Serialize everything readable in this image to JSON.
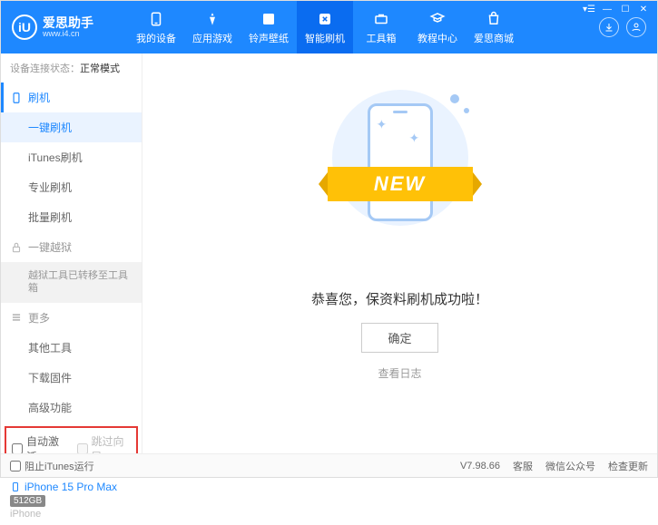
{
  "header": {
    "logo_badge": "iU",
    "logo_title": "爱思助手",
    "logo_sub": "www.i4.cn"
  },
  "topnav": [
    {
      "label": "我的设备"
    },
    {
      "label": "应用游戏"
    },
    {
      "label": "铃声壁纸"
    },
    {
      "label": "智能刷机"
    },
    {
      "label": "工具箱"
    },
    {
      "label": "教程中心"
    },
    {
      "label": "爱思商城"
    }
  ],
  "status": {
    "label": "设备连接状态：",
    "value": "正常模式"
  },
  "sidebar": {
    "flash_header": "刷机",
    "flash_items": [
      "一键刷机",
      "iTunes刷机",
      "专业刷机",
      "批量刷机"
    ],
    "jailbreak_header": "一键越狱",
    "jailbreak_note": "越狱工具已转移至工具箱",
    "more_header": "更多",
    "more_items": [
      "其他工具",
      "下载固件",
      "高级功能"
    ],
    "auto_activate": "自动激活",
    "skip_guide": "跳过向导"
  },
  "device": {
    "name": "iPhone 15 Pro Max",
    "storage": "512GB",
    "type": "iPhone"
  },
  "main": {
    "new_text": "NEW",
    "success_msg": "恭喜您，保资料刷机成功啦！",
    "ok_btn": "确定",
    "log_link": "查看日志"
  },
  "footer": {
    "block_itunes": "阻止iTunes运行",
    "version": "V7.98.66",
    "links": [
      "客服",
      "微信公众号",
      "检查更新"
    ]
  }
}
